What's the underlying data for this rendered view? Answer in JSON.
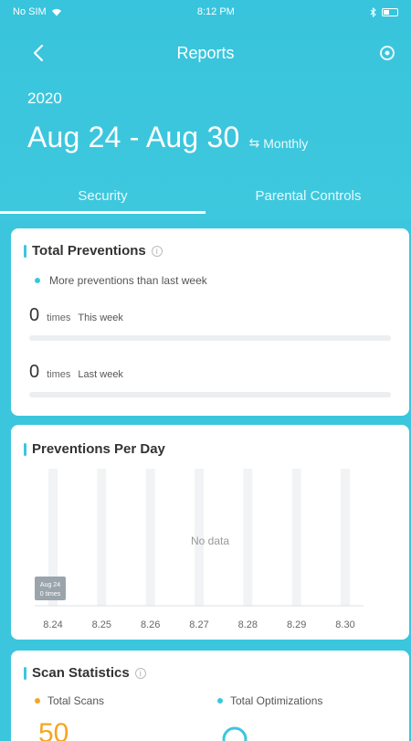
{
  "status_bar": {
    "carrier": "No SIM",
    "time": "8:12 PM"
  },
  "nav": {
    "title": "Reports"
  },
  "period": {
    "year": "2020",
    "range": "Aug 24 - Aug 30",
    "toggle_label": "Monthly",
    "toggle_symbol": "⇆"
  },
  "tabs": [
    {
      "label": "Security",
      "active": true
    },
    {
      "label": "Parental Controls",
      "active": false
    }
  ],
  "total_preventions": {
    "title": "Total Preventions",
    "hint": "More preventions than last week",
    "this_week": {
      "value": "0",
      "unit": "times",
      "label": "This week",
      "fraction": 0
    },
    "last_week": {
      "value": "0",
      "unit": "times",
      "label": "Last week",
      "fraction": 0
    }
  },
  "preventions_per_day": {
    "title": "Preventions Per Day",
    "empty_text": "No data",
    "tooltip_lines": [
      "Aug 24",
      "0 times"
    ]
  },
  "chart_data": {
    "type": "bar",
    "title": "Preventions Per Day",
    "categories": [
      "8.24",
      "8.25",
      "8.26",
      "8.27",
      "8.28",
      "8.29",
      "8.30"
    ],
    "values": [
      0,
      0,
      0,
      0,
      0,
      0,
      0
    ],
    "xlabel": "",
    "ylabel": "",
    "grid": true
  },
  "scan_statistics": {
    "title": "Scan Statistics",
    "legend": [
      {
        "label": "Total Scans",
        "color": "#f5a623"
      },
      {
        "label": "Total Optimizations",
        "color": "#3cc6dd"
      }
    ],
    "scans_value": "50"
  },
  "colors": {
    "accent": "#3cc6dd",
    "orange": "#f5a623"
  },
  "icons": {
    "back": "chevron-left-icon",
    "settings": "gear-icon",
    "info": "info-icon"
  }
}
